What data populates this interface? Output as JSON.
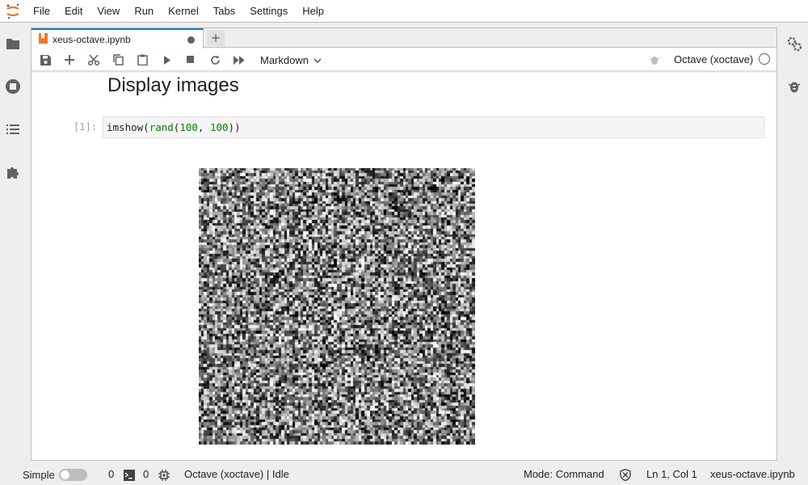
{
  "menubar": {
    "items": [
      "File",
      "Edit",
      "View",
      "Run",
      "Kernel",
      "Tabs",
      "Settings",
      "Help"
    ]
  },
  "left_sidebar": {
    "icons": [
      "folder-icon",
      "running-icon",
      "toc-icon",
      "extension-icon"
    ]
  },
  "right_sidebar": {
    "icons": [
      "property-inspector-icon",
      "debugger-icon"
    ]
  },
  "tab": {
    "label": "xeus-octave.ipynb",
    "dirty": true,
    "new_tab_label": "+"
  },
  "toolbar": {
    "cell_type": "Markdown",
    "kernel_name": "Octave (xoctave)",
    "kernel_idle": true
  },
  "notebook": {
    "heading": "Display images",
    "cell": {
      "prompt": "[1]:",
      "code": {
        "fn1": "imshow",
        "p1": "(",
        "fn2": "rand",
        "p2": "(",
        "n1": "100",
        "sep": ", ",
        "n2": "100",
        "p3": "))"
      }
    },
    "output_image": {
      "kind": "random-grayscale-noise",
      "grid": [
        100,
        100
      ]
    }
  },
  "statusbar": {
    "simple_label": "Simple",
    "simple_enabled": false,
    "terminals": "0",
    "kernels": "0",
    "kernel_status": "Octave (xoctave) | Idle",
    "mode": "Mode: Command",
    "cursor": "Ln 1, Col 1",
    "filename": "xeus-octave.ipynb"
  },
  "colors": {
    "accent": "#1976d2",
    "jupyter_orange": "#f37726",
    "code_green": "#008000"
  }
}
